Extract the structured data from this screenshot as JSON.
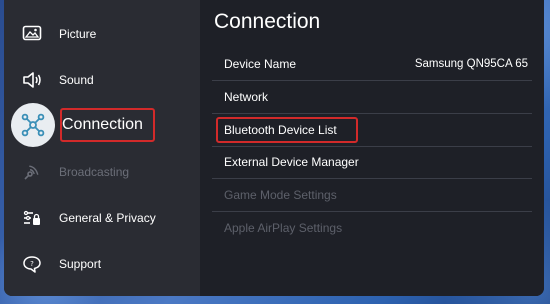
{
  "sidebar": {
    "items": [
      {
        "label": "Picture",
        "icon": "picture-icon"
      },
      {
        "label": "Sound",
        "icon": "sound-icon"
      },
      {
        "label": "Connection",
        "icon": "connection-icon",
        "selected": true
      },
      {
        "label": "Broadcasting",
        "icon": "broadcasting-icon",
        "disabled": true
      },
      {
        "label": "General & Privacy",
        "icon": "general-privacy-icon"
      },
      {
        "label": "Support",
        "icon": "support-icon"
      }
    ]
  },
  "main": {
    "title": "Connection",
    "rows": [
      {
        "label": "Device Name",
        "value": "Samsung QN95CA 65"
      },
      {
        "label": "Network"
      },
      {
        "label": "Bluetooth Device List"
      },
      {
        "label": "External Device Manager"
      },
      {
        "label": "Game Mode Settings",
        "disabled": true
      },
      {
        "label": "Apple AirPlay Settings",
        "disabled": true
      }
    ]
  },
  "colors": {
    "highlight_box": "#d22a2a",
    "panel_bg": "#1e2027",
    "sidebar_bg": "#2a2c33",
    "selected_circle": "#e9edf1"
  }
}
